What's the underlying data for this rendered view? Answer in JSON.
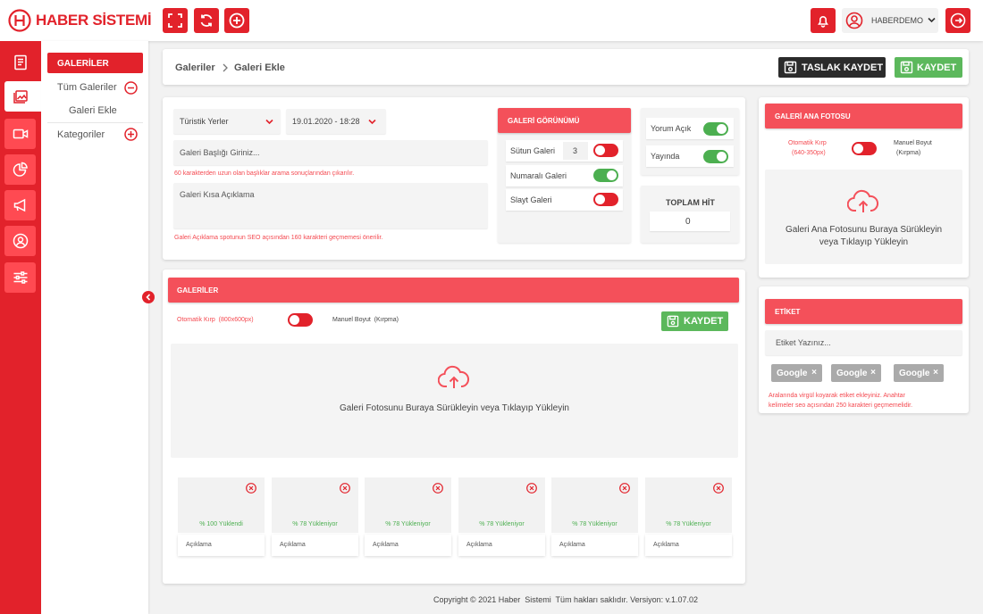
{
  "brand": {
    "name": "HABER SİSTEMİ",
    "color": "#e2222b"
  },
  "topbar": {
    "user_name": "HABERDEMO",
    "icons": [
      "expand-icon",
      "refresh-icon",
      "add-icon"
    ],
    "notification_icon": "bell-icon",
    "logout_icon": "logout-icon"
  },
  "sidebar": {
    "icons": [
      "news-icon",
      "gallery-icon",
      "video-icon",
      "chart-icon",
      "megaphone-icon",
      "user-icon",
      "settings-icon"
    ],
    "menu_title": "GALERİLER",
    "items": [
      {
        "label": "Tüm Galeriler",
        "action": "minus"
      },
      {
        "label": "Galeri Ekle"
      },
      {
        "label": "Kategoriler",
        "action": "plus"
      }
    ]
  },
  "header": {
    "breadcrumb_root": "Galeriler",
    "breadcrumb_current": "Galeri Ekle",
    "draft_label": "TASLAK KAYDET",
    "save_label": "KAYDET"
  },
  "form": {
    "category": "Türistik Yerler",
    "date": "19.01.2020 - 18:28",
    "title_placeholder": "Galeri Başlığı Giriniz...",
    "title_hint": "60 karakterden uzun olan başlıklar arama sonuçlarından çıkarılır.",
    "desc_placeholder": "Galeri Kısa Açıklama",
    "desc_hint": "Galeri Açıklama spotunun SEO açısından 160 karakteri geçmemesi önerilir."
  },
  "view": {
    "title": "GALERİ GÖRÜNÜMÜ",
    "rows": [
      {
        "label": "Sütun Galeri",
        "value": "3",
        "state": "off"
      },
      {
        "label": "Numaralı Galeri",
        "state": "on"
      },
      {
        "label": "Slayt Galeri",
        "state": "off"
      }
    ]
  },
  "options": {
    "rows": [
      {
        "label": "Yorum Açık",
        "state": "on"
      },
      {
        "label": "Yayında",
        "state": "on"
      }
    ],
    "hit_label": "TOPLAM HİT",
    "hit_value": "0"
  },
  "main_photo": {
    "title": "GALERİ ANA FOTOSU",
    "auto_crop": "Otomatik Kırp",
    "auto_crop_size": "(640-350px)",
    "manual": "Manuel Boyut",
    "manual_sub": "(Kırpma)",
    "drop_line1": "Galeri Ana Fotosunu Buraya Sürükleyin",
    "drop_line2": "veya Tıklayıp Yükleyin"
  },
  "tags": {
    "title": "ETİKET",
    "placeholder": "Etiket Yazınız...",
    "items": [
      "Google",
      "Google",
      "Google"
    ],
    "hint_line1": "Aralarında virgül koyarak etiket ekleyiniz. Anahtar",
    "hint_line2": "kelimeler seo açısından 250 karakteri geçmemelidir."
  },
  "gallery": {
    "title": "GALERİLER",
    "auto_crop": "Otomatik Kırp  (800x600px)",
    "manual": "Manuel Boyut  (Kırpma)",
    "save_label": "KAYDET",
    "drop_text": "Galeri Fotosunu Buraya Sürükleyin veya Tıklayıp Yükleyin",
    "thumbs": [
      {
        "status": "% 100 Yüklendi",
        "desc": "Açıklama"
      },
      {
        "status": "% 78 Yükleniyor",
        "desc": "Açıklama"
      },
      {
        "status": "% 78 Yükleniyor",
        "desc": "Açıklama"
      },
      {
        "status": "% 78 Yükleniyor",
        "desc": "Açıklama"
      },
      {
        "status": "% 78 Yükleniyor",
        "desc": "Açıklama"
      },
      {
        "status": "% 78 Yükleniyor",
        "desc": "Açıklama"
      }
    ]
  },
  "footer": {
    "text": "Copyright © 2021 Haber  Sistemi  Tüm hakları saklıdır. Versiyon: v.1.07.02"
  }
}
